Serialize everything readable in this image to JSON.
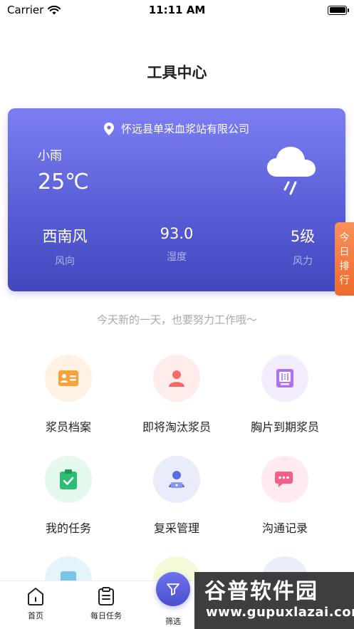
{
  "status_bar": {
    "carrier": "Carrier",
    "time": "11:11 AM"
  },
  "header": {
    "title": "工具中心"
  },
  "weather": {
    "location": "怀远县单采血浆站有限公司",
    "condition": "小雨",
    "temperature": "25℃",
    "wind_direction": "西南风",
    "wind_direction_label": "风向",
    "humidity": "93.0",
    "humidity_label": "湿度",
    "wind_force": "5级",
    "wind_force_label": "风力"
  },
  "rank_tab": {
    "chars": [
      "今",
      "日",
      "排",
      "行"
    ]
  },
  "slogan": "今天新的一天，也要努力工作哦～",
  "tools": [
    {
      "label": "浆员档案",
      "icon": "id-card-icon",
      "bg": "#fff2e3",
      "color": "#f6a33b"
    },
    {
      "label": "即将淘汰浆员",
      "icon": "person-icon",
      "bg": "#ffeceb",
      "color": "#f06a66"
    },
    {
      "label": "胸片到期浆员",
      "icon": "xray-icon",
      "bg": "#f3ecfd",
      "color": "#b26ff0"
    },
    {
      "label": "我的任务",
      "icon": "clipboard-check-icon",
      "bg": "#e5f8ee",
      "color": "#2dbd72"
    },
    {
      "label": "复采管理",
      "icon": "operator-icon",
      "bg": "#e9edfb",
      "color": "#5a6ee0"
    },
    {
      "label": "沟通记录",
      "icon": "chat-icon",
      "bg": "#ffeaf0",
      "color": "#f0608a"
    }
  ],
  "tab_bar": {
    "home": "首页",
    "daily_tasks": "每日任务",
    "filter": "筛选"
  },
  "watermark": {
    "title": "谷普软件园",
    "url": "www.gupuxlazai.com"
  }
}
